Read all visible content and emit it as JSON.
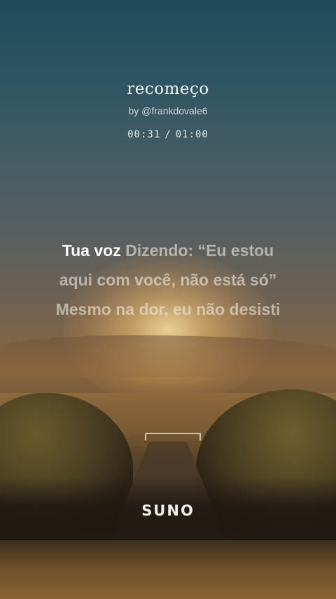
{
  "track": {
    "title": "recomeço",
    "author": "by @frankdovale6",
    "time_current": "00:31",
    "time_separator": "/",
    "time_total": "01:00"
  },
  "lyrics": {
    "line1_active": "Tua voz",
    "line1_upcoming": "Dizendo: “Eu estou",
    "line2": "aqui com você, não está só”",
    "line3": "Mesmo na dor, eu não desisti"
  },
  "brand": {
    "logo_text": "SUNO"
  },
  "colors": {
    "sky_top": "#1f4a5a",
    "horizon": "#86653f",
    "sun_glow": "#ffe2a0",
    "active_lyric": "#ffffff",
    "upcoming_lyric": "#ebe6de"
  }
}
